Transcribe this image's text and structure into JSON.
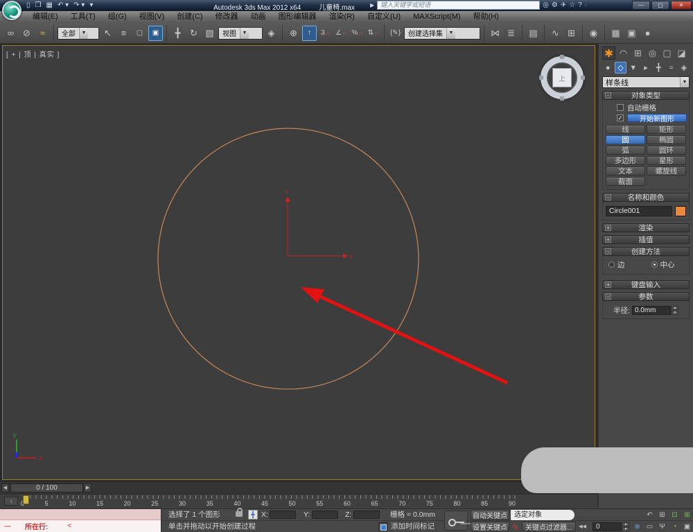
{
  "window": {
    "title_app": "Autodesk 3ds Max  2012 x64",
    "title_file": "儿童椅.max",
    "search_placeholder": "键入关键字或短语",
    "minimize": "—",
    "maximize": "▢",
    "close": "✕"
  },
  "menubar": {
    "items": [
      "编辑(E)",
      "工具(T)",
      "组(G)",
      "视图(V)",
      "创建(C)",
      "修改器",
      "动画",
      "图形编辑器",
      "渲染(R)",
      "自定义(U)",
      "MAXScript(M)",
      "帮助(H)"
    ]
  },
  "toolbar": {
    "filter_dropdown": "全部",
    "reference_dropdown": "视图",
    "selection_set_dropdown": "创建选择集",
    "snap_label": "3"
  },
  "viewport": {
    "label_open": "[",
    "label_plus": "+",
    "label_view": "顶",
    "label_shading": "真实",
    "label_close": "]",
    "viewcube_face": "上"
  },
  "panel": {
    "category_dropdown": "样条线",
    "object_type": {
      "title": "对象类型",
      "autogrid": "自动栅格",
      "start_new_shape": "开始新图形",
      "check_mark": "✓",
      "buttons": [
        "线",
        "矩形",
        "圆",
        "椭圆",
        "弧",
        "圆环",
        "多边形",
        "星形",
        "文本",
        "螺旋线",
        "截面"
      ],
      "active_button": "圆"
    },
    "name_color": {
      "title": "名称和颜色",
      "name_value": "Circle001",
      "color_hex": "#e98a3c"
    },
    "rollouts": {
      "rendering": "渲染",
      "interpolation": "插值",
      "creation_method": "创建方法",
      "keyboard_entry": "键盘输入",
      "parameters": "参数"
    },
    "creation_method": {
      "edge": "边",
      "center": "中心",
      "selected": "中心"
    },
    "parameters": {
      "radius_label": "半径:",
      "radius_value": "0.0mm"
    }
  },
  "timeline": {
    "frame_indicator": "0 / 100",
    "frame_labels": [
      "0",
      "5",
      "10",
      "15",
      "20",
      "25",
      "30",
      "35",
      "40",
      "45",
      "50",
      "55",
      "60",
      "65",
      "70",
      "75",
      "80",
      "85",
      "90"
    ]
  },
  "statusbar": {
    "selection_status": "选择了 1 个图形",
    "prompt": "单击并拖动以开始创建过程",
    "listener_dash": "一",
    "listener_label": "所在行:",
    "listener_caret": "<",
    "x_label": "X:",
    "y_label": "Y:",
    "z_label": "Z:",
    "grid_label": "栅格 = 0.0mm",
    "time_tag": "添加时间标记",
    "auto_key": "自动关键点",
    "set_key": "设置关键点",
    "selected_object": "选定对象",
    "key_filters": "关键点过滤器...",
    "frame_field": "0"
  },
  "colors": {
    "accent_blue": "#3f6fb0",
    "create_tab_orange": "#f7941d",
    "circle_stroke": "#bf8457",
    "annotation_red": "#e11212",
    "object_color": "#e98a3c",
    "viewport_border": "#9a7f2c"
  }
}
